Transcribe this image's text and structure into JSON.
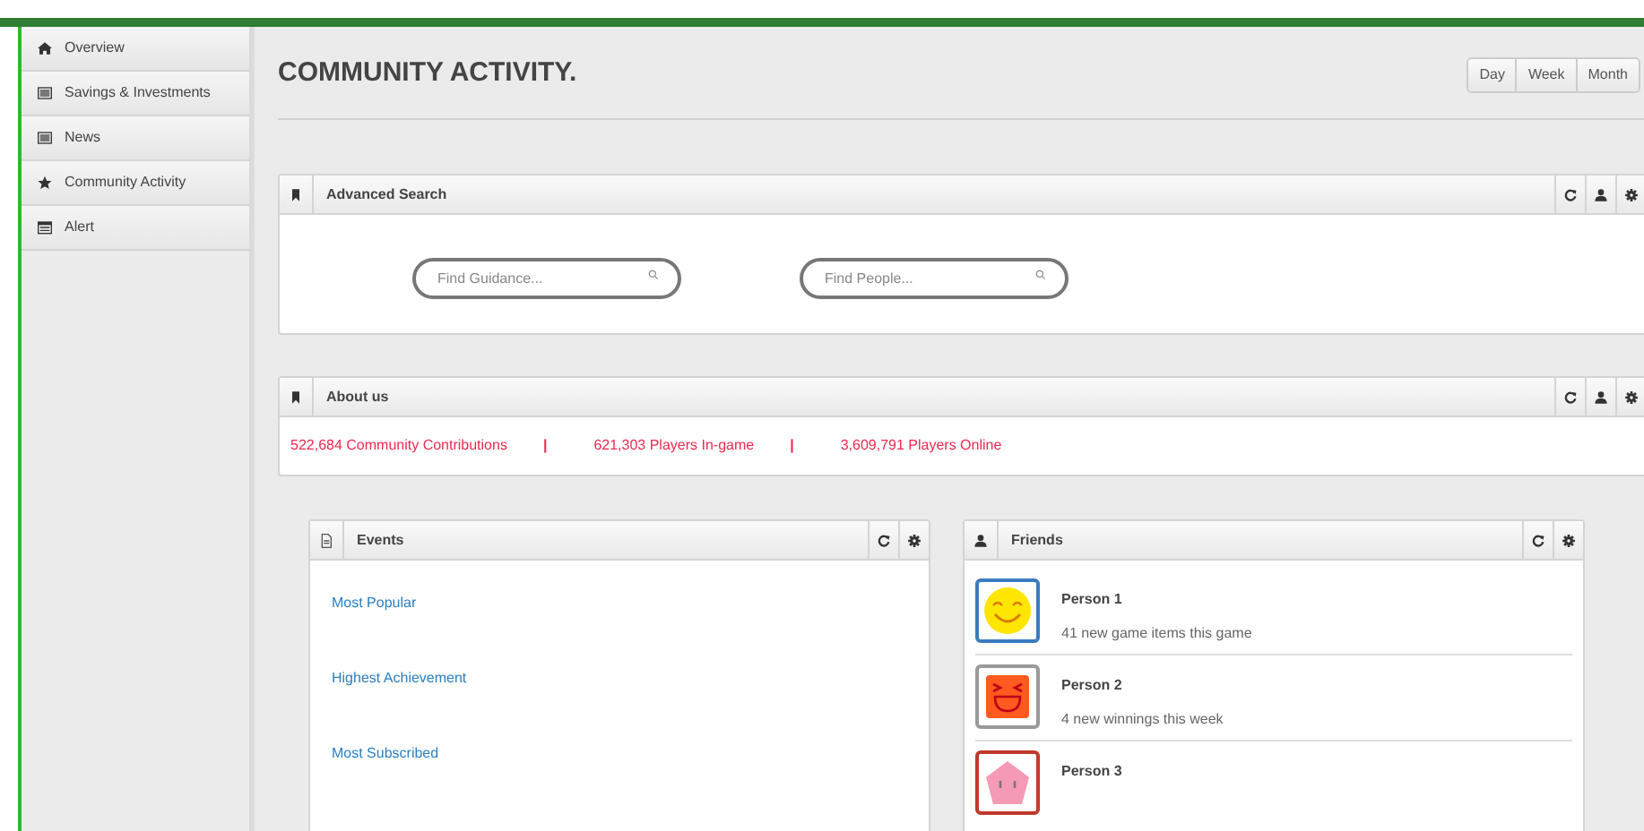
{
  "sidebar": {
    "items": [
      {
        "label": "Overview"
      },
      {
        "label": "Savings & Investments"
      },
      {
        "label": "News"
      },
      {
        "label": "Community Activity"
      },
      {
        "label": "Alert"
      }
    ]
  },
  "page_title": "COMMUNITY ACTIVITY.",
  "period_buttons": [
    "Day",
    "Week",
    "Month"
  ],
  "advanced_search": {
    "title": "Advanced Search",
    "fields": [
      {
        "placeholder": "Find Guidance..."
      },
      {
        "placeholder": "Find People..."
      }
    ]
  },
  "about_us": {
    "title": "About us",
    "stats": [
      "522,684 Community Contributions",
      "621,303 Players In-game",
      "3,609,791 Players Online"
    ],
    "separator": "|"
  },
  "events": {
    "title": "Events",
    "links": [
      "Most Popular",
      "Highest Achievement",
      "Most Subscribed"
    ]
  },
  "friends": {
    "title": "Friends",
    "people": [
      {
        "name": "Person 1",
        "detail": "41 new game items this game",
        "color": "#3a7cc0"
      },
      {
        "name": "Person 2",
        "detail": "4 new winnings this week",
        "color": "#9a9a9a"
      },
      {
        "name": "Person 3",
        "color": "#c0392b"
      }
    ]
  }
}
